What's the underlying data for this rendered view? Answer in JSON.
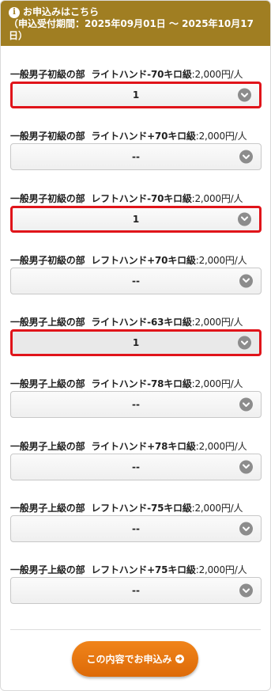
{
  "header": {
    "title": "お申込みはこちら",
    "period": "（申込受付期間：2025年09月01日 〜 2025年10月17日）"
  },
  "items": [
    {
      "division": "一般男子初級の部",
      "category": "ライトハンド-70キロ級",
      "price": ":2,000円/人",
      "value": "1",
      "highlighted": true
    },
    {
      "division": "一般男子初級の部",
      "category": "ライトハンド+70キロ級",
      "price": ":2,000円/人",
      "value": "--",
      "highlighted": false
    },
    {
      "division": "一般男子初級の部",
      "category": "レフトハンド-70キロ級",
      "price": ":2,000円/人",
      "value": "1",
      "highlighted": true
    },
    {
      "division": "一般男子初級の部",
      "category": "レフトハンド+70キロ級",
      "price": ":2,000円/人",
      "value": "--",
      "highlighted": false
    },
    {
      "division": "一般男子上級の部",
      "category": "ライトハンド-63キロ級",
      "price": ":2,000円/人",
      "value": "1",
      "highlighted": true
    },
    {
      "division": "一般男子上級の部",
      "category": "ライトハンド-78キロ級",
      "price": ":2,000円/人",
      "value": "--",
      "highlighted": false
    },
    {
      "division": "一般男子上級の部",
      "category": "ライトハンド+78キロ級",
      "price": ":2,000円/人",
      "value": "--",
      "highlighted": false
    },
    {
      "division": "一般男子上級の部",
      "category": "レフトハンド-75キロ級",
      "price": ":2,000円/人",
      "value": "--",
      "highlighted": false
    },
    {
      "division": "一般男子上級の部",
      "category": "レフトハンド+75キロ級",
      "price": ":2,000円/人",
      "value": "--",
      "highlighted": false
    }
  ],
  "submit": {
    "label": "この内容でお申込み",
    "icon": "arrow-right-circle-icon"
  },
  "colors": {
    "header": "#a07e22",
    "highlight": "#e0141a",
    "button": "#e2720c"
  }
}
